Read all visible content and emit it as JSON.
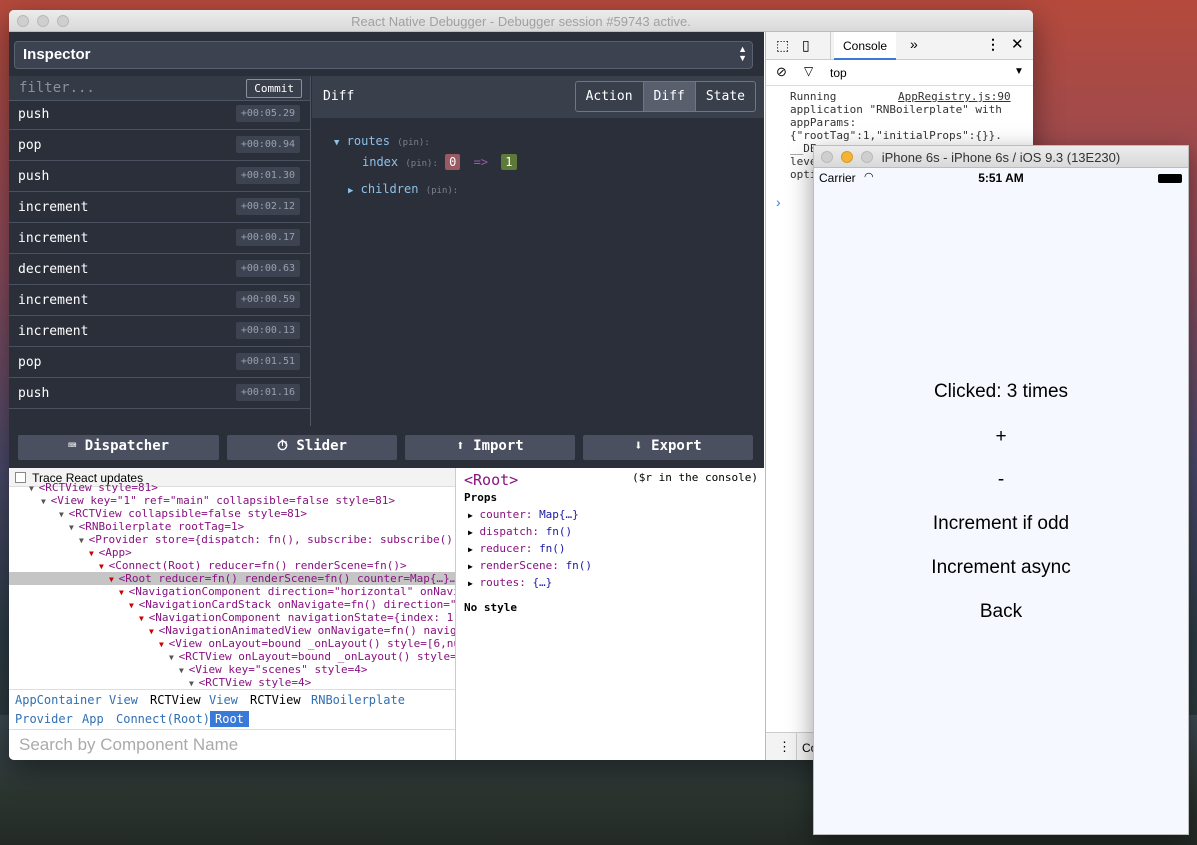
{
  "window": {
    "title": "React Native Debugger - Debugger session #59743 active."
  },
  "redux": {
    "monitor_label": "Inspector",
    "filter_placeholder": "filter...",
    "commit_label": "Commit",
    "actions": [
      {
        "name": "push",
        "time": "+00:05.29"
      },
      {
        "name": "pop",
        "time": "+00:00.94"
      },
      {
        "name": "push",
        "time": "+00:01.30"
      },
      {
        "name": "increment",
        "time": "+00:02.12"
      },
      {
        "name": "increment",
        "time": "+00:00.17"
      },
      {
        "name": "decrement",
        "time": "+00:00.63"
      },
      {
        "name": "increment",
        "time": "+00:00.59"
      },
      {
        "name": "increment",
        "time": "+00:00.13"
      },
      {
        "name": "pop",
        "time": "+00:01.51"
      },
      {
        "name": "push",
        "time": "+00:01.16"
      }
    ],
    "diff_title": "Diff",
    "tabs": [
      "Action",
      "Diff",
      "State"
    ],
    "active_tab": "Diff",
    "diff": {
      "routes_key": "routes",
      "pin": "(pin):",
      "index_key": "index",
      "old_value": "0",
      "arrow": "=>",
      "new_value": "1",
      "children_key": "children"
    },
    "toolbar": {
      "dispatcher": "Dispatcher",
      "slider": "Slider",
      "import": "Import",
      "export": "Export"
    }
  },
  "rn_inspector": {
    "trace_label": "Trace React updates",
    "tree": [
      "<RCTView style=81>",
      "<View key=\"1\" ref=\"main\" collapsible=false style=81>",
      "<RCTView collapsible=false style=81>",
      "<RNBoilerplate rootTag=1>",
      "<Provider store={dispatch: fn(), subscribe: subscribe(),",
      "<App>",
      "<Connect(Root) reducer=fn() renderScene=fn()>",
      "<Root reducer=fn() renderScene=fn() counter=Map{…}…>",
      "<NavigationComponent direction=\"horizontal\" onNavi",
      "<NavigationCardStack onNavigate=fn() direction=\"h",
      "<NavigationComponent navigationState={index: 1,",
      "<NavigationAnimatedView onNavigate=fn() naviga",
      "<View onLayout=bound _onLayout() style=[6,nu",
      "<RCTView onLayout=bound _onLayout() style=[",
      "<View key=\"scenes\" style=4>",
      "<RCTView style=4>"
    ],
    "breadcrumbs": [
      "AppContainer",
      "View",
      "RCTView",
      "View",
      "RCTView",
      "RNBoilerplate",
      "Provider",
      "App",
      "Connect(Root)",
      "Root"
    ],
    "search_placeholder": "Search by Component Name",
    "selected_title": "<Root>",
    "console_hint": "($r in the console)",
    "props_title": "Props",
    "props": [
      {
        "key": "counter:",
        "value": "Map{…}"
      },
      {
        "key": "dispatch:",
        "value": "fn()"
      },
      {
        "key": "reducer:",
        "value": "fn()"
      },
      {
        "key": "renderScene:",
        "value": "fn()"
      },
      {
        "key": "routes:",
        "value": "{…}"
      }
    ],
    "no_style": "No style"
  },
  "devtools": {
    "tab_console": "Console",
    "context": "top",
    "log_lines": [
      "Running",
      "application \"RNBoilerplate\" with",
      "appParams:",
      "{\"rootTag\":1,\"initialProps\":{}}.",
      "__DE",
      "leve",
      "opti"
    ],
    "log_source": "AppRegistry.js:90",
    "bottom_label": "Co"
  },
  "simulator": {
    "title": "iPhone 6s - iPhone 6s / iOS 9.3 (13E230)",
    "carrier": "Carrier",
    "time": "5:51 AM",
    "clicked": "Clicked: 3 times",
    "plus": "+",
    "minus": "-",
    "inc_odd": "Increment if odd",
    "inc_async": "Increment async",
    "back": "Back"
  }
}
